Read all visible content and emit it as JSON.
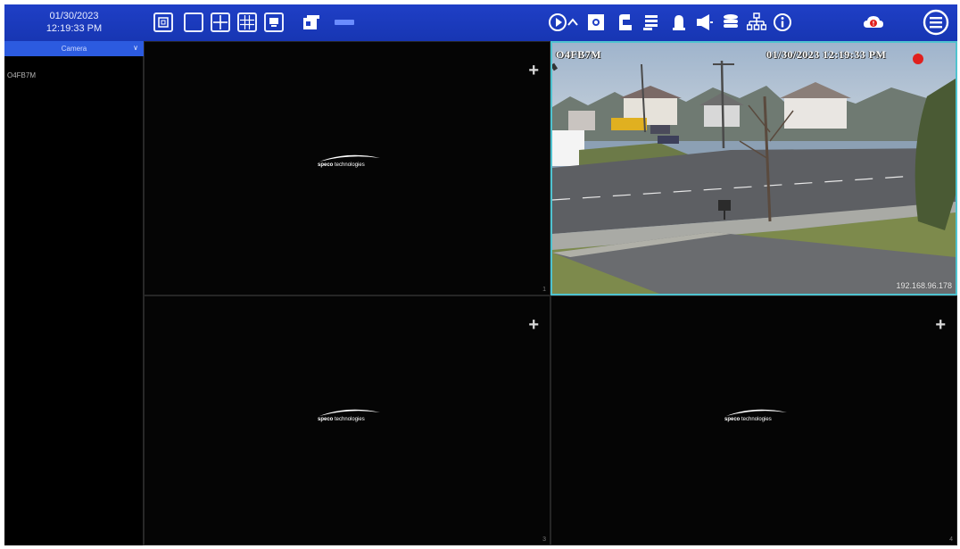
{
  "clock": {
    "date": "01/30/2023",
    "time": "12:19:33 PM"
  },
  "toolbar": {
    "left_icons": [
      "fullscreen-icon",
      "layout-1-icon",
      "layout-4-icon",
      "layout-9-icon",
      "display-icon",
      "window-icon",
      "condensed-bar-icon"
    ],
    "right_icons": [
      "play-icon",
      "caret-up-icon",
      "snapshot-icon",
      "record-icon",
      "event-list-icon",
      "alarm-light-icon",
      "speaker-icon",
      "disk-icon",
      "network-icon",
      "info-icon",
      "alert-cloud-icon",
      "menu-icon"
    ]
  },
  "sidebar": {
    "dropdown_label": "Camera",
    "cameras": [
      "O4FB7M"
    ]
  },
  "tiles": [
    {
      "logo_brand": "speco",
      "logo_text": "technologies",
      "channel": "1"
    },
    {
      "osd_name": "O4FB7M",
      "osd_datetime": "01/30/2023 12:19:33 PM",
      "ip": "192.168.96.178"
    },
    {
      "logo_brand": "speco",
      "logo_text": "technologies",
      "channel": "3"
    },
    {
      "logo_brand": "speco",
      "logo_text": "technologies",
      "channel": "4"
    }
  ],
  "colors": {
    "topbar": "#1f3fc6",
    "dropdown": "#2c5be0",
    "selected_border": "#4fc3d0",
    "alert_red": "#e0201e"
  }
}
